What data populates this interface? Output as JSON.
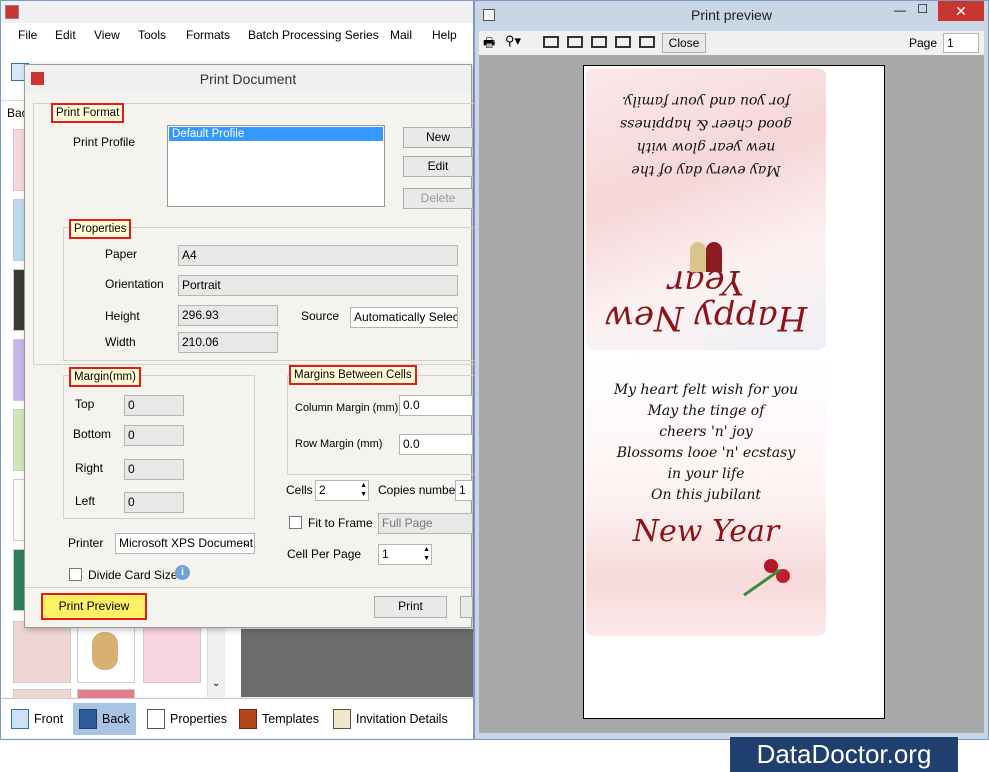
{
  "menu": [
    "File",
    "Edit",
    "View",
    "Tools",
    "Formats",
    "Batch Processing Series",
    "Mail",
    "Help"
  ],
  "thumb_strip": {
    "label": "Bac"
  },
  "bottom_tabs": [
    {
      "label": "Front"
    },
    {
      "label": "Back"
    },
    {
      "label": "Properties"
    },
    {
      "label": "Templates"
    },
    {
      "label": "Invitation Details"
    }
  ],
  "dialog": {
    "title": "Print Document",
    "print_format": {
      "heading": "Print Format",
      "profile_label": "Print Profile",
      "profiles": [
        "Default Profile"
      ],
      "new": "New",
      "edit": "Edit",
      "delete": "Delete"
    },
    "properties": {
      "heading": "Properties",
      "paper_label": "Paper",
      "paper": "A4",
      "orientation_label": "Orientation",
      "orientation": "Portrait",
      "height_label": "Height",
      "height": "296.93",
      "width_label": "Width",
      "width": "210.06",
      "source_label": "Source",
      "source": "Automatically Select"
    },
    "margin": {
      "heading": "Margin(mm)",
      "top_label": "Top",
      "top": "0",
      "bottom_label": "Bottom",
      "bottom": "0",
      "right_label": "Right",
      "right": "0",
      "left_label": "Left",
      "left": "0"
    },
    "margins_between": {
      "heading": "Margins Between Cells",
      "column_label": "Column Margin (mm)",
      "column": "0.0",
      "row_label": "Row Margin (mm)",
      "row": "0.0"
    },
    "cells_label": "Cells",
    "cells": "2",
    "copies_label": "Copies number",
    "copies": "1",
    "fit_label": "Fit to Frame",
    "fit_value": "Full Page",
    "cell_per_page_label": "Cell Per Page",
    "cell_per_page": "1",
    "printer_label": "Printer",
    "printer": "Microsoft XPS Document Writer",
    "divide_label": "Divide Card Size",
    "print_preview": "Print Preview",
    "print": "Print"
  },
  "preview": {
    "title": "Print preview",
    "close": "Close",
    "page_label": "Page",
    "page_value": "1",
    "top_card": {
      "lines": [
        "May every day of the",
        "new year glow with",
        "good cheer & happiness",
        "for you and your family."
      ],
      "script": "Happy New Year"
    },
    "bottom_card": {
      "lines": [
        "My heart felt wish for you",
        "May the tinge of",
        "cheers 'n' joy",
        "Blossoms looe 'n' ecstasy",
        "in your life",
        "On this jubilant"
      ],
      "script": "New Year"
    }
  },
  "watermark": "DataDoctor.org"
}
